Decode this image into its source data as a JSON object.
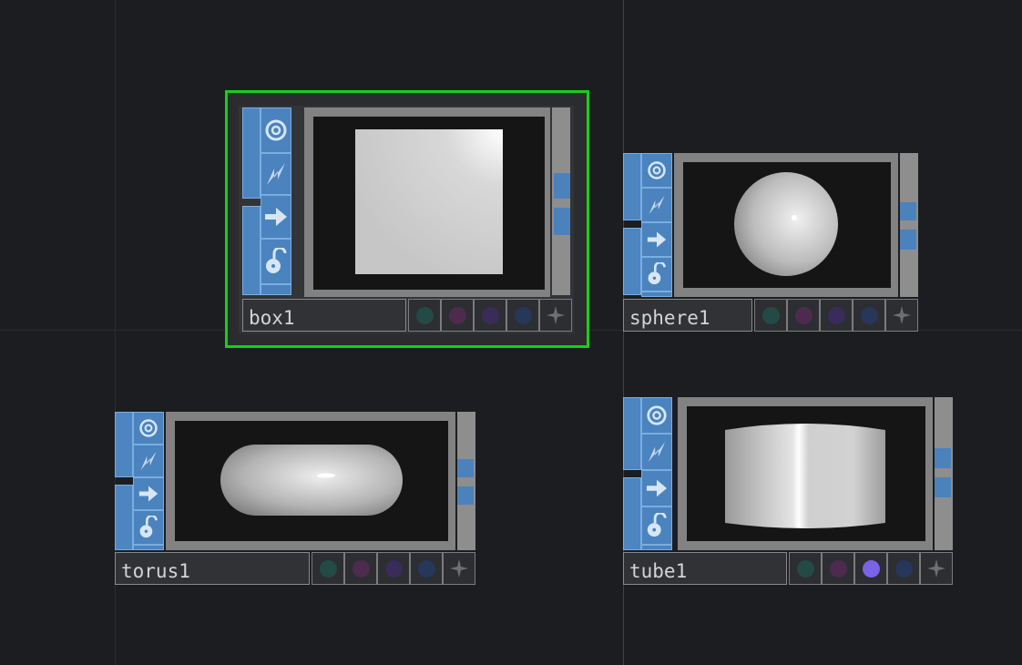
{
  "nodes": [
    {
      "id": "box1",
      "name": "box1",
      "selected": true,
      "preview": "box"
    },
    {
      "id": "sphere1",
      "name": "sphere1",
      "selected": false,
      "preview": "sphere"
    },
    {
      "id": "torus1",
      "name": "torus1",
      "selected": false,
      "preview": "torus"
    },
    {
      "id": "tube1",
      "name": "tube1",
      "selected": false,
      "preview": "tube"
    }
  ],
  "flag_icons": [
    "target-icon",
    "bypass-icon",
    "arrow-icon",
    "lock-icon"
  ],
  "flag_dots": [
    "cooking",
    "display",
    "render",
    "template",
    "pin"
  ],
  "colors": {
    "background": "#1c1d21",
    "selection": "#17d017",
    "flag_blue": "#4a83be",
    "active_dot": "#7b63e8"
  },
  "active_dots": {
    "tube1": 2
  }
}
